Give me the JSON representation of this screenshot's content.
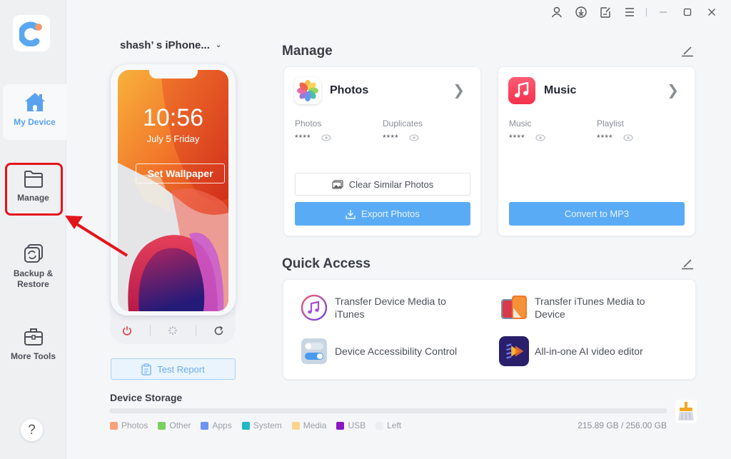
{
  "app": {
    "logo": "app-logo"
  },
  "sidebar": {
    "items": [
      {
        "id": "my-device",
        "label": "My Device",
        "icon": "home-icon",
        "active": true
      },
      {
        "id": "manage",
        "label": "Manage",
        "icon": "folder-icon",
        "active": false,
        "highlighted": true
      },
      {
        "id": "backup-restore",
        "label": "Backup &\nRestore",
        "label_line1": "Backup &",
        "label_line2": "Restore",
        "icon": "backup-restore-icon",
        "active": false
      },
      {
        "id": "more-tools",
        "label": "More Tools",
        "icon": "toolbox-icon",
        "active": false
      }
    ],
    "help_label": "?"
  },
  "titlebar": {
    "icons": [
      "user-icon",
      "download-icon",
      "feedback-icon",
      "menu-icon",
      "minimize-icon",
      "maximize-icon",
      "close-icon"
    ]
  },
  "device": {
    "name": "shash’ s iPhone...",
    "time": "10:56",
    "date": "July 5 Friday",
    "set_wallpaper_label": "Set Wallpaper",
    "controls": [
      "power-icon",
      "loading-icon",
      "refresh-icon"
    ],
    "test_report_label": "Test Report"
  },
  "manage": {
    "title": "Manage",
    "cards": [
      {
        "title": "Photos",
        "icon": "photos-app-icon",
        "stats": [
          {
            "label": "Photos",
            "value": "****"
          },
          {
            "label": "Duplicates",
            "value": "****"
          }
        ],
        "secondary_button": "Clear Similar Photos",
        "primary_button": "Export Photos"
      },
      {
        "title": "Music",
        "icon": "music-app-icon",
        "stats": [
          {
            "label": "Music",
            "value": "****"
          },
          {
            "label": "Playlist",
            "value": "****"
          }
        ],
        "primary_button": "Convert to MP3"
      }
    ]
  },
  "quick_access": {
    "title": "Quick Access",
    "items": [
      {
        "label": "Transfer Device Media to iTunes",
        "icon": "itunes-icon"
      },
      {
        "label": "Transfer iTunes Media to Device",
        "icon": "phones-icon"
      },
      {
        "label": "Device Accessibility Control",
        "icon": "toggle-icon"
      },
      {
        "label": "All-in-one AI video editor",
        "icon": "video-editor-icon"
      }
    ]
  },
  "storage": {
    "title": "Device Storage",
    "used": "215.89 GB",
    "total": "256.00 GB",
    "display": "215.89 GB / 256.00 GB",
    "legend": [
      {
        "label": "Photos",
        "color": "#f7a07d"
      },
      {
        "label": "Other",
        "color": "#7ccf5e"
      },
      {
        "label": "Apps",
        "color": "#6b93f2"
      },
      {
        "label": "System",
        "color": "#1fb9c4"
      },
      {
        "label": "Media",
        "color": "#fcd58a"
      },
      {
        "label": "USB",
        "color": "#8a16c4"
      },
      {
        "label": "Left",
        "color": "#ecedf0"
      }
    ]
  },
  "colors": {
    "accent": "#5aabf5",
    "highlight": "#e4141b"
  }
}
